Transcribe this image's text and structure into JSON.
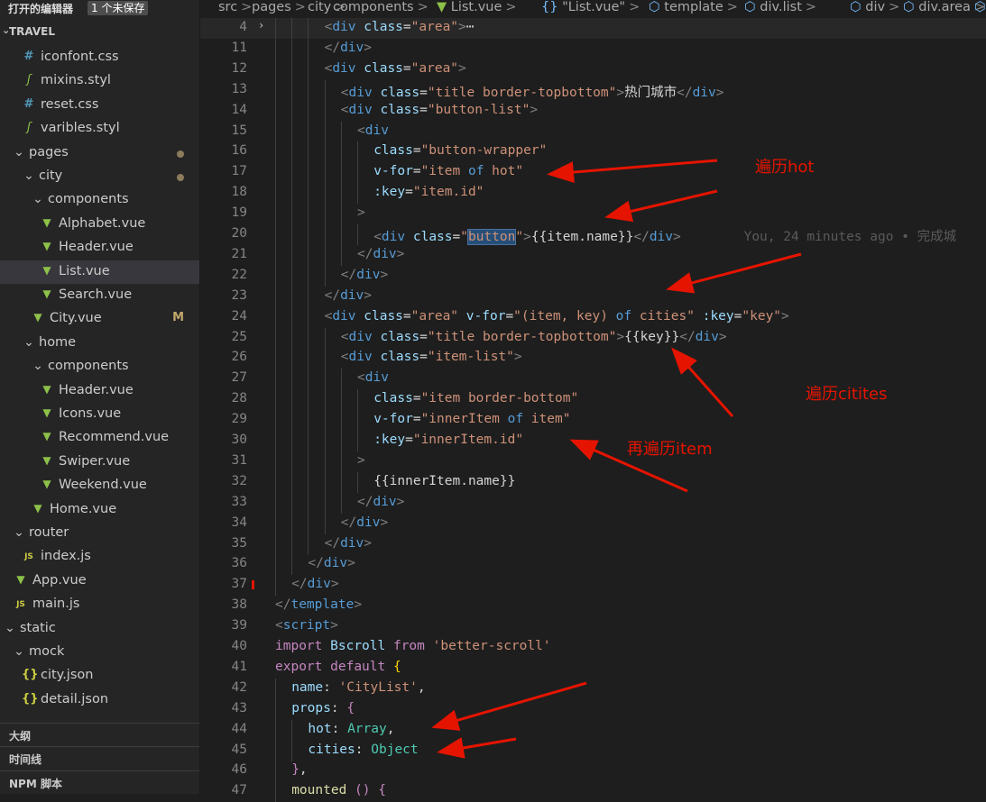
{
  "sidebar": {
    "open_editors_title": "打开的编辑器",
    "unsaved_badge": "1 个未保存",
    "project_title": "TRAVEL",
    "tree": [
      {
        "label": "iconfont.css",
        "icon": "css-hash-icon",
        "glyph": "#"
      },
      {
        "label": "mixins.styl",
        "icon": "stylus-icon",
        "glyph": "ʃ"
      },
      {
        "label": "reset.css",
        "icon": "css-hash-icon",
        "glyph": "#"
      },
      {
        "label": "varibles.styl",
        "icon": "stylus-icon",
        "glyph": "ʃ"
      },
      {
        "label": "pages",
        "icon": "chevron-down-icon",
        "glyph": "⌄"
      },
      {
        "label": "city",
        "icon": "chevron-down-icon",
        "glyph": "⌄"
      },
      {
        "label": "components",
        "icon": "chevron-down-icon",
        "glyph": "⌄"
      },
      {
        "label": "Alphabet.vue",
        "icon": "vue-icon",
        "glyph": "▼"
      },
      {
        "label": "Header.vue",
        "icon": "vue-icon",
        "glyph": "▼"
      },
      {
        "label": "List.vue",
        "icon": "vue-icon",
        "glyph": "▼"
      },
      {
        "label": "Search.vue",
        "icon": "vue-icon",
        "glyph": "▼"
      },
      {
        "label": "City.vue",
        "icon": "vue-icon",
        "glyph": "▼",
        "status": "M"
      },
      {
        "label": "home",
        "icon": "chevron-down-icon",
        "glyph": "⌄"
      },
      {
        "label": "components",
        "icon": "chevron-down-icon",
        "glyph": "⌄"
      },
      {
        "label": "Header.vue",
        "icon": "vue-icon",
        "glyph": "▼"
      },
      {
        "label": "Icons.vue",
        "icon": "vue-icon",
        "glyph": "▼"
      },
      {
        "label": "Recommend.vue",
        "icon": "vue-icon",
        "glyph": "▼"
      },
      {
        "label": "Swiper.vue",
        "icon": "vue-icon",
        "glyph": "▼"
      },
      {
        "label": "Weekend.vue",
        "icon": "vue-icon",
        "glyph": "▼"
      },
      {
        "label": "Home.vue",
        "icon": "vue-icon",
        "glyph": "▼"
      },
      {
        "label": "router",
        "icon": "chevron-down-icon",
        "glyph": "⌄"
      },
      {
        "label": "index.js",
        "icon": "js-icon",
        "glyph": "JS"
      },
      {
        "label": "App.vue",
        "icon": "vue-icon",
        "glyph": "▼"
      },
      {
        "label": "main.js",
        "icon": "js-icon",
        "glyph": "JS"
      },
      {
        "label": "static",
        "icon": "chevron-down-icon",
        "glyph": "⌄"
      },
      {
        "label": "mock",
        "icon": "chevron-down-icon",
        "glyph": "⌄"
      },
      {
        "label": "city.json",
        "icon": "json-icon",
        "glyph": "{}"
      },
      {
        "label": "detail.json",
        "icon": "json-icon",
        "glyph": "{}"
      }
    ],
    "sections": [
      "大纲",
      "时间线",
      "NPM 脚本"
    ]
  },
  "breadcrumb": {
    "parts": [
      "src",
      "pages",
      "city",
      "components",
      "List.vue",
      "\"List.vue\"",
      "template",
      "div.list",
      "div",
      "div.area",
      "di"
    ],
    "separator": ">"
  },
  "editor": {
    "line_numbers": [
      "4",
      "11",
      "12",
      "13",
      "14",
      "15",
      "16",
      "17",
      "18",
      "19",
      "20",
      "21",
      "22",
      "23",
      "24",
      "25",
      "26",
      "27",
      "28",
      "29",
      "30",
      "31",
      "32",
      "33",
      "34",
      "35",
      "36",
      "37",
      "38",
      "39",
      "40",
      "41",
      "42",
      "43",
      "44",
      "45",
      "46",
      "47"
    ],
    "strings": {
      "tag_div": "div",
      "tag_template": "template",
      "tag_script": "script",
      "attr_class": "class",
      "attr_vfor": "v-for",
      "attr_key": ":key",
      "str_area": "\"area\"",
      "str_title": "\"title border-topbottom\"",
      "txt_hot_city": "热门城市",
      "str_button_list": "\"button-list\"",
      "str_button_wrapper": "\"button-wrapper\"",
      "str_item_of_hot_open": "\"item ",
      "kw_of": "of",
      "str_hot_close": " hot\"",
      "str_item_id": "\"item.id\"",
      "str_button": "button",
      "txt_item_name": "{{item.name}}",
      "str_vfor_cities": "\"(item, key) ",
      "str_cities_close": " cities\"",
      "str_key": "\"key\"",
      "txt_key": "{{key}}",
      "str_item_list": "\"item-list\"",
      "str_item_border": "\"item border-bottom\"",
      "str_inner_open": "\"innerItem ",
      "str_inner_close": " item\"",
      "str_inner_id": "\"innerItem.id\"",
      "txt_inner_name": "{{innerItem.name}}",
      "kw_import": "import",
      "txt_bscroll": "Bscroll",
      "kw_from": "from",
      "str_better_scroll": "'better-scroll'",
      "kw_export": "export",
      "kw_default": "default",
      "prop_name": "name",
      "str_citylist": "'CityList'",
      "prop_props": "props",
      "prop_hot": "hot",
      "type_array": "Array",
      "prop_cities": "cities",
      "type_object": "Object",
      "fn_mounted": "mounted",
      "fold_ellipsis": "⋯",
      "blame": "You, 24 minutes ago • 完成城"
    }
  },
  "annotations": {
    "hot": "遍历hot",
    "cities": "遍历citites",
    "item": "再遍历item"
  },
  "colors": {
    "annotation": "#e51400",
    "editor_bg": "#1e1e1e",
    "sidebar_bg": "#252526",
    "selected": "#37373d"
  }
}
